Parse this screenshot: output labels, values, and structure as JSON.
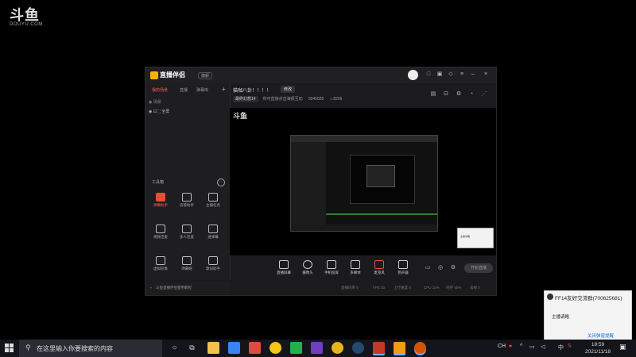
{
  "watermark": {
    "logo": "斗鱼",
    "sub": "DOUYU.COM"
  },
  "app": {
    "name": "直播伴侣",
    "version": "旗舰",
    "left_tabs": [
      "我的场景",
      "直播",
      "弹幕库"
    ],
    "scene_rows": [
      "场景",
      "全屏"
    ],
    "tools_title": "工具箱",
    "tools": [
      {
        "label": "弹幕助手",
        "icon": "danmu-icon",
        "highlight": true
      },
      {
        "label": "房管助手",
        "icon": "user-icon",
        "highlight": false
      },
      {
        "label": "主播任务",
        "icon": "task-icon",
        "highlight": false
      },
      {
        "label": "视频连麦",
        "icon": "video-link-icon",
        "highlight": false
      },
      {
        "label": "多人连麦",
        "icon": "multi-link-icon",
        "highlight": false
      },
      {
        "label": "送弹幕",
        "icon": "send-danmu-icon",
        "highlight": false
      },
      {
        "label": "虚拟形象",
        "icon": "avatar-icon",
        "highlight": false
      },
      {
        "label": "弹幕姬",
        "icon": "danmu-ji-icon",
        "highlight": false
      },
      {
        "label": "歌词助手",
        "icon": "lyrics-icon",
        "highlight": false
      }
    ],
    "notice": "斗鱼直播伴侣使用教程",
    "room_title": "猫咖八卦！！！！",
    "modify_label": "修改",
    "meta": {
      "category": "最终幻想14",
      "hint": "你可直接点击海报互动",
      "room_id": "9945685",
      "hot": "8206"
    },
    "preview_watermark": "斗鱼",
    "toolbar": [
      {
        "label": "直播屏幕",
        "icon": "screen-icon"
      },
      {
        "label": "摄像头",
        "icon": "camera-icon"
      },
      {
        "label": "手机投屏",
        "icon": "phone-cast-icon"
      },
      {
        "label": "多媒体",
        "icon": "media-icon"
      },
      {
        "label": "麦克风",
        "icon": "mic-icon"
      },
      {
        "label": "扬声器",
        "icon": "speaker-icon"
      }
    ],
    "start_label": "开始直播",
    "status": [
      "直播码率 0",
      "FPS 30",
      "上行速度 0",
      "CPU 10%",
      "内存 40%",
      "丢帧 0"
    ]
  },
  "notification": {
    "title": "FF14友好交流群(700625681)",
    "body": "主播请略",
    "link": "关闭弹窗提醒"
  },
  "taskbar": {
    "search_placeholder": "在这里输入你要搜索的内容",
    "apps": [
      {
        "name": "cortana",
        "color": "#1e1e1e"
      },
      {
        "name": "task-view",
        "color": "#1e1e1e"
      },
      {
        "name": "file-explorer",
        "color": "#f2c14e"
      },
      {
        "name": "mail",
        "color": "#3b82f6"
      },
      {
        "name": "store",
        "color": "#e04a3f"
      },
      {
        "name": "wechat",
        "color": "#f5c518"
      },
      {
        "name": "wechat-green",
        "color": "#22b14c"
      },
      {
        "name": "visual-studio",
        "color": "#6f3fbf"
      },
      {
        "name": "chrome",
        "color": "#e9b31b"
      },
      {
        "name": "steam",
        "color": "#224b6e"
      },
      {
        "name": "game",
        "color": "#c0392b"
      },
      {
        "name": "douyu",
        "color": "#f39c12"
      },
      {
        "name": "camera",
        "color": "#d35400"
      }
    ],
    "tray_lang": "中",
    "time": "18:59",
    "date": "2021/11/18"
  }
}
